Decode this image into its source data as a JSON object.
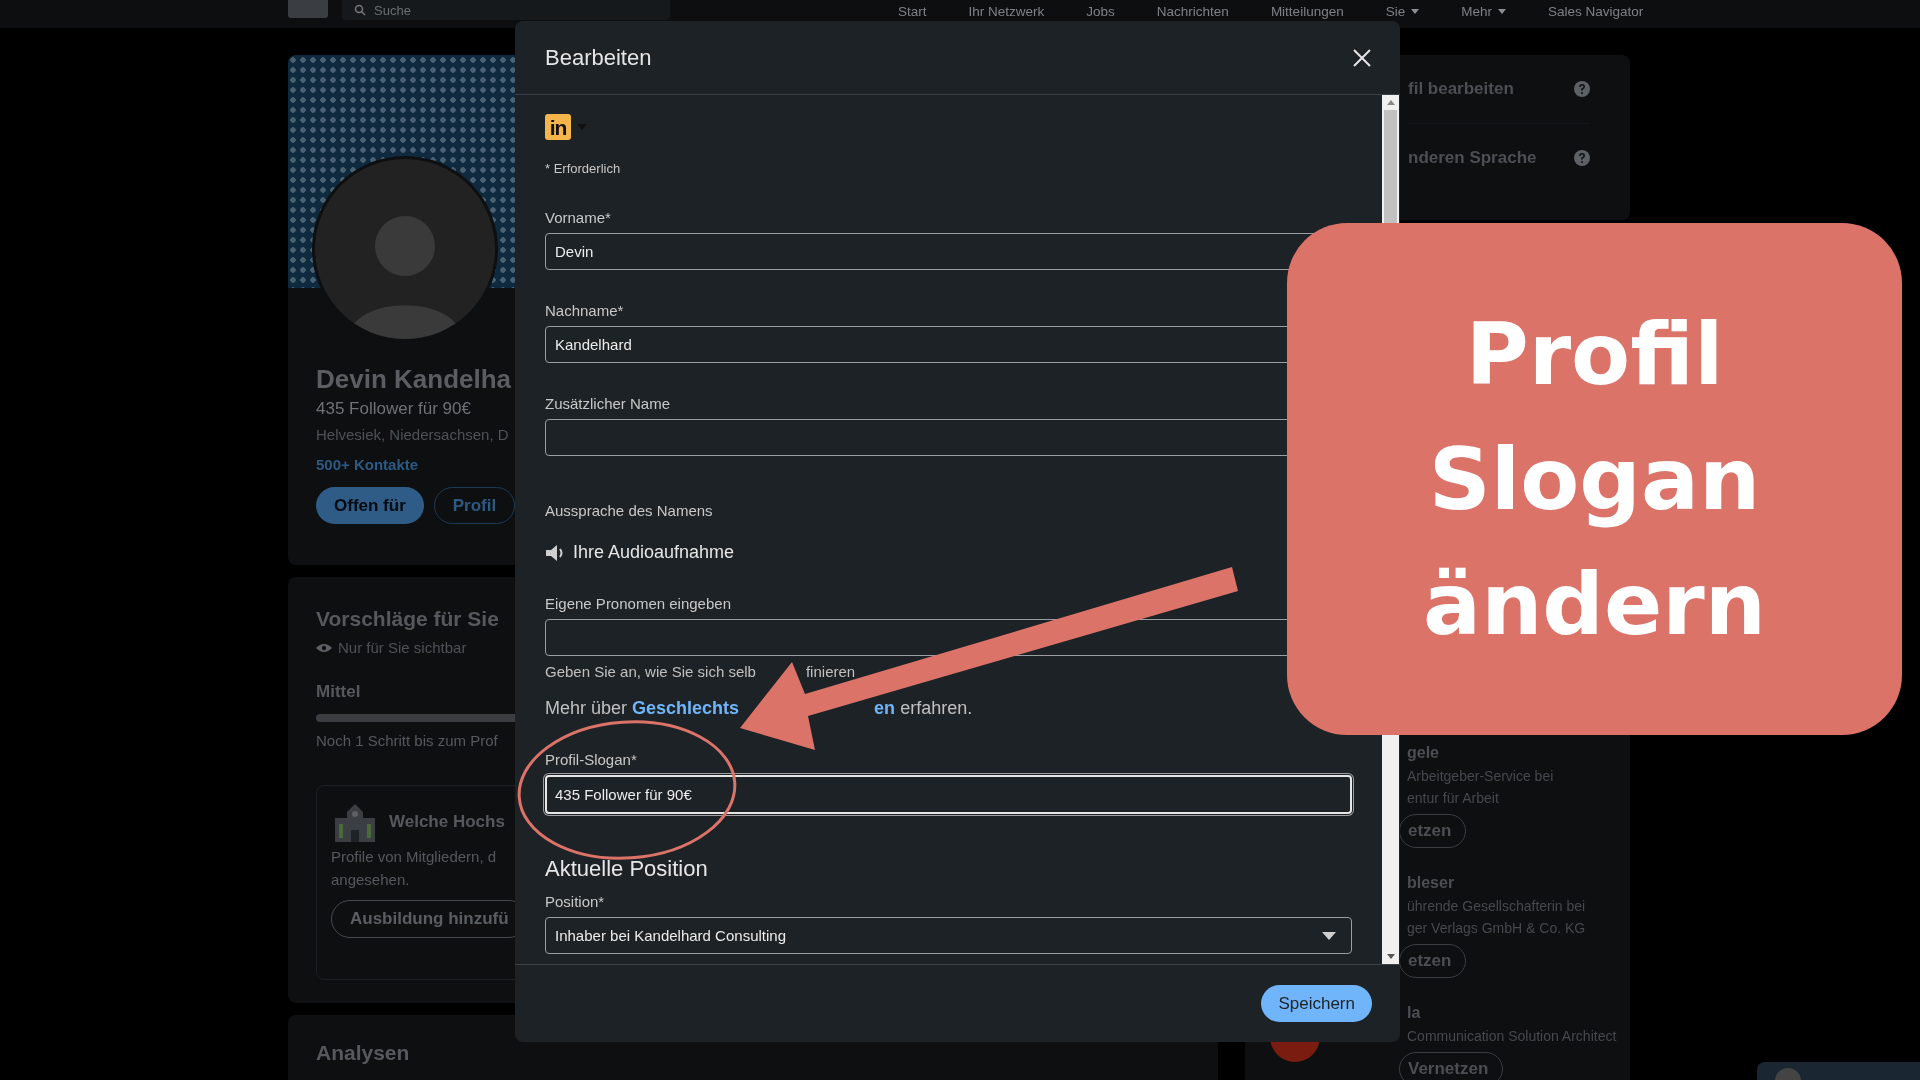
{
  "nav": {
    "search_placeholder": "Suche",
    "items": [
      {
        "label": "Start",
        "dropdown": false
      },
      {
        "label": "Ihr Netzwerk",
        "dropdown": false
      },
      {
        "label": "Jobs",
        "dropdown": false
      },
      {
        "label": "Nachrichten",
        "dropdown": false
      },
      {
        "label": "Mitteilungen",
        "dropdown": false
      },
      {
        "label": "Sie",
        "dropdown": true
      },
      {
        "label": "Mehr",
        "dropdown": true
      },
      {
        "label": "Sales Navigator",
        "dropdown": false
      }
    ]
  },
  "profile_card": {
    "name": "Devin Kandelha",
    "headline": "435 Follower für 90€",
    "location": "Helvesiek, Niedersachsen, D",
    "connections": "500+ Kontakte",
    "buttons": [
      {
        "label": "Offen für",
        "kind": "primary"
      },
      {
        "label": "Profil",
        "kind": "outline"
      }
    ]
  },
  "suggestions_card": {
    "title": "Vorschläge für Sie",
    "visibility": "Nur für Sie sichtbar",
    "strength": "Mittel",
    "next_step": "Noch 1 Schritt bis zum Prof",
    "prompt": {
      "title": "Welche Hochs",
      "text_lines": [
        "Profile von Mitgliedern, d",
        "angesehen."
      ],
      "button": "Ausbildung hinzufü"
    }
  },
  "analytics_card": {
    "title": "Analysen"
  },
  "sidebar": {
    "links": [
      "fil bearbeiten",
      "nderen Sprache"
    ],
    "people": [
      {
        "name": "gele",
        "lines": [
          "Arbeitgeber-Service bei",
          "entur für Arbeit"
        ],
        "button": "etzen",
        "photo": false
      },
      {
        "name": "bleser",
        "lines": [
          "ührende Gesellschafterin bei",
          "ger Verlags GmbH & Co. KG"
        ],
        "button": "etzen",
        "photo": false
      },
      {
        "name": "la",
        "lines": [
          "Communication Solution Architect"
        ],
        "button": "Vernetzen",
        "photo": true
      }
    ]
  },
  "dialog": {
    "title": "Bearbeiten",
    "logo_text": "in",
    "required_note": "* Erforderlich",
    "fields": [
      {
        "kind": "input",
        "label": "Vorname*",
        "value": "Devin",
        "focused": false
      },
      {
        "kind": "input",
        "label": "Nachname*",
        "value": "Kandelhard",
        "focused": false
      },
      {
        "kind": "input",
        "label": "Zusätzlicher Name",
        "focused": false
      },
      {
        "kind": "audio",
        "label": "Aussprache des Namens",
        "action": "Ihre Audioaufnahme"
      },
      {
        "kind": "input",
        "label": "Eigene Pronomen eingeben",
        "focused": false,
        "helper": [
          "Geben Sie an, wie Sie sich selb",
          "finieren"
        ],
        "note": {
          "before": "Mehr über",
          "link": [
            "Geschlechts",
            "en"
          ],
          "after": "erfahren."
        }
      },
      {
        "kind": "input",
        "label": "Profil-Slogan*",
        "value": "435 Follower für 90€",
        "focused": true
      },
      {
        "kind": "heading",
        "text": "Aktuelle Position"
      },
      {
        "kind": "select",
        "label": "Position*",
        "value": "Inhaber bei Kandelhard Consulting"
      }
    ],
    "save": "Speichern"
  },
  "overlay": {
    "lines": [
      "Profil",
      "Slogan",
      "ändern"
    ]
  }
}
